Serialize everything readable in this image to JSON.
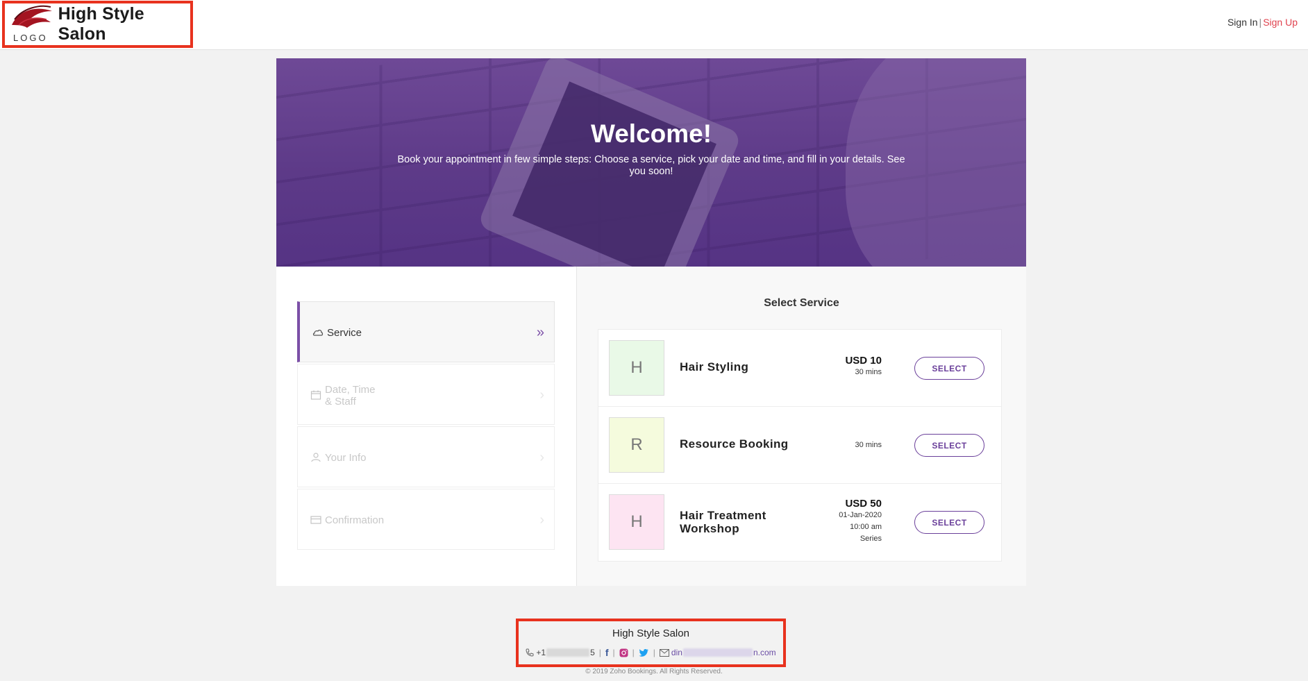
{
  "header": {
    "logo_text": "LOGO",
    "brand_name": "High Style Salon",
    "sign_in": "Sign In",
    "separator": "|",
    "sign_up": "Sign Up",
    "accent_color": "#e0424e"
  },
  "hero": {
    "title": "Welcome!",
    "subtitle": "Book your appointment in few simple steps: Choose a service, pick your date and time, and fill in your details. See you soon!"
  },
  "steps": [
    {
      "label": "Service",
      "icon": "cloud-icon",
      "active": true
    },
    {
      "label_line1": "Date, Time",
      "label_line2": "& Staff",
      "icon": "calendar-icon",
      "active": false
    },
    {
      "label": "Your Info",
      "icon": "user-icon",
      "active": false
    },
    {
      "label": "Confirmation",
      "icon": "card-icon",
      "active": false
    }
  ],
  "services": {
    "title": "Select Service",
    "items": [
      {
        "initial": "H",
        "name": "Hair Styling",
        "price": "USD 10",
        "duration": "30 mins",
        "button": "SELECT",
        "avatar_color": "#e9f9e7"
      },
      {
        "initial": "R",
        "name": "Resource Booking",
        "duration": "30 mins",
        "button": "SELECT",
        "avatar_color": "#f5fbdd"
      },
      {
        "initial": "H",
        "name_line1": "Hair Treatment",
        "name_line2": "Workshop",
        "price": "USD 50",
        "date": "01-Jan-2020",
        "time": "10:00 am",
        "type": "Series",
        "button": "SELECT",
        "avatar_color": "#fde4f2"
      }
    ]
  },
  "footer": {
    "name": "High Style Salon",
    "phone_prefix": "+1",
    "phone_suffix": "5",
    "email_prefix": "din",
    "email_suffix": "n.com",
    "copyright": "© 2019 Zoho Bookings. All Rights Reserved."
  },
  "colors": {
    "primary": "#6a3f9a",
    "hero_purple": "#5d3a88",
    "highlight_border": "#e8321e"
  }
}
